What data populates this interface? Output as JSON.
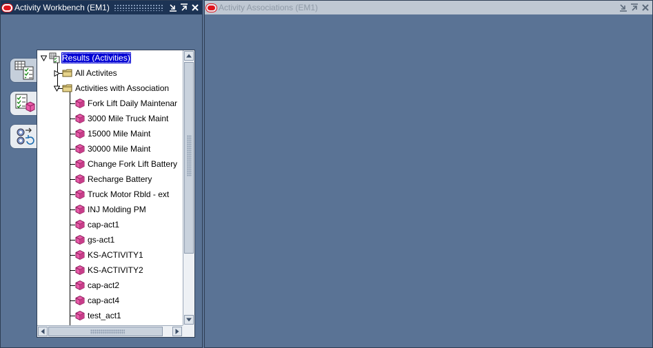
{
  "windows": {
    "left": {
      "title": "Activity Workbench (EM1)",
      "state": "active"
    },
    "right": {
      "title": "Activity Associations (EM1)",
      "state": "inactive"
    }
  },
  "side_buttons": [
    {
      "icon": "results-grid-icon",
      "selected": true
    },
    {
      "icon": "checklist-activity-icon",
      "selected": false
    },
    {
      "icon": "gears-refresh-icon",
      "selected": false
    }
  ],
  "tree": {
    "root": {
      "label": "Results (Activities)",
      "expanded": true,
      "selected": true
    },
    "folders": [
      {
        "label": "All Activites",
        "expanded": false
      },
      {
        "label": "Activities with Association",
        "expanded": true
      }
    ],
    "activities": [
      "Fork Lift Daily Maintenar",
      "3000 Mile Truck Maint",
      "15000 Mile Maint",
      "30000 Mile Maint",
      "Change Fork Lift Battery",
      "Recharge Battery",
      "Truck Motor Rbld - ext",
      "INJ Molding PM",
      "cap-act1",
      "gs-act1",
      "KS-ACTIVITY1",
      "KS-ACTIVITY2",
      "cap-act2",
      "cap-act4",
      "test_act1"
    ]
  },
  "colors": {
    "desktop": "#5a7395",
    "active_title": "#1c3354",
    "inactive_title": "#bfc8d3",
    "selection": "#0000d4",
    "activity_cube": "#e85aa8",
    "folder": "#e6d38a"
  }
}
